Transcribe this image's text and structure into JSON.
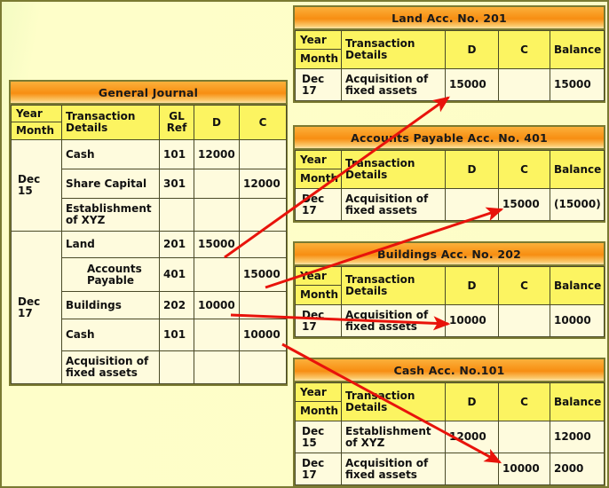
{
  "colors": {
    "background": "#FBFBC9",
    "frame_border": "#7A7A32",
    "title_orange": "#F78E12",
    "header_yellow": "#FCF461",
    "cell_cream": "#FEFBDD",
    "arrow_red": "#E8130B"
  },
  "journal": {
    "title": "General Journal",
    "columns": {
      "year": "Year",
      "month": "Month",
      "details": "Transaction Details",
      "gl_ref_line1": "GL",
      "gl_ref_line2": "Ref",
      "debit": "D",
      "credit": "C"
    },
    "entries": [
      {
        "date_line1": "Dec",
        "date_line2": "15",
        "rows": [
          {
            "details": "Cash",
            "indent": false,
            "gl_ref": "101",
            "debit": "12000",
            "credit": ""
          },
          {
            "details": "Share Capital",
            "indent": true,
            "gl_ref": "301",
            "debit": "",
            "credit": "12000"
          },
          {
            "details": "Establishment of XYZ",
            "indent": false,
            "gl_ref": "",
            "debit": "",
            "credit": ""
          }
        ]
      },
      {
        "date_line1": "Dec",
        "date_line2": "17",
        "rows": [
          {
            "details": "Land",
            "indent": false,
            "gl_ref": "201",
            "debit": "15000",
            "credit": ""
          },
          {
            "details": "Accounts Payable",
            "indent": true,
            "gl_ref": "401",
            "debit": "",
            "credit": "15000"
          },
          {
            "details": "Buildings",
            "indent": false,
            "gl_ref": "202",
            "debit": "10000",
            "credit": ""
          },
          {
            "details": "Cash",
            "indent": true,
            "gl_ref": "101",
            "debit": "",
            "credit": "10000"
          },
          {
            "details": "Acquisition of fixed assets",
            "indent": false,
            "gl_ref": "",
            "debit": "",
            "credit": ""
          }
        ]
      }
    ]
  },
  "ledger_columns": {
    "year": "Year",
    "month": "Month",
    "details": "Transaction Details",
    "debit": "D",
    "credit": "C",
    "balance": "Balance"
  },
  "ledgers": [
    {
      "id": "land",
      "title": "Land Acc. No. 201",
      "rows": [
        {
          "date_line1": "Dec",
          "date_line2": "17",
          "details": "Acquisition of fixed assets",
          "debit": "15000",
          "credit": "",
          "balance": "15000"
        }
      ]
    },
    {
      "id": "accounts-payable",
      "title": "Accounts Payable Acc. No. 401",
      "rows": [
        {
          "date_line1": "Dec",
          "date_line2": "17",
          "details": "Acquisition of fixed assets",
          "debit": "",
          "credit": "15000",
          "balance": "(15000)"
        }
      ]
    },
    {
      "id": "buildings",
      "title": "Buildings Acc. No. 202",
      "rows": [
        {
          "date_line1": "Dec",
          "date_line2": "17",
          "details": "Acquisition of fixed assets",
          "debit": "10000",
          "credit": "",
          "balance": "10000"
        }
      ]
    },
    {
      "id": "cash",
      "title": "Cash Acc. No.101",
      "rows": [
        {
          "date_line1": "Dec",
          "date_line2": "15",
          "details": "Establishment of XYZ",
          "debit": "12000",
          "credit": "",
          "balance": "12000"
        },
        {
          "date_line1": "Dec",
          "date_line2": "17",
          "details": "Acquisition of fixed assets",
          "debit": "",
          "credit": "10000",
          "balance": "2000"
        }
      ]
    }
  ],
  "arrows": [
    {
      "name": "land-posting-arrow",
      "from_label": "journal Land debit 15000",
      "to_label": "Land ledger debit 15000"
    },
    {
      "name": "accounts-payable-posting-arrow",
      "from_label": "journal Accounts Payable credit 15000",
      "to_label": "Accounts Payable ledger credit 15000"
    },
    {
      "name": "buildings-posting-arrow",
      "from_label": "journal Buildings debit 10000",
      "to_label": "Buildings ledger debit 10000"
    },
    {
      "name": "cash-posting-arrow",
      "from_label": "journal Cash credit 10000",
      "to_label": "Cash ledger credit 10000"
    }
  ]
}
